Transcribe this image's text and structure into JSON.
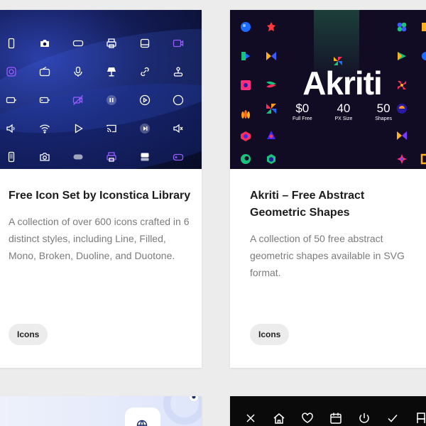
{
  "cards": [
    {
      "title": "Free Icon Set by Iconstica Library",
      "description": "A collection of over 600 icons crafted in 6 distinct styles, including Line, Filled, Mono, Broken, Duoline, and Duotone.",
      "tag": "Icons"
    },
    {
      "title": "Akriti – Free Abstract Geometric Shapes",
      "description": "A collection of 50 free abstract geometric shapes available in SVG format.",
      "tag": "Icons",
      "thumbnail": {
        "name": "Akriti",
        "stats": [
          {
            "value": "$0",
            "label": "Full Free"
          },
          {
            "value": "40",
            "label": "PX Size"
          },
          {
            "value": "50",
            "label": "Shapes"
          }
        ]
      }
    }
  ],
  "colors": {
    "page_bg": "#ececec",
    "card_bg": "#ffffff",
    "title": "#1c1c1c",
    "description": "#7b7b7b",
    "tag_bg": "#ececec"
  }
}
